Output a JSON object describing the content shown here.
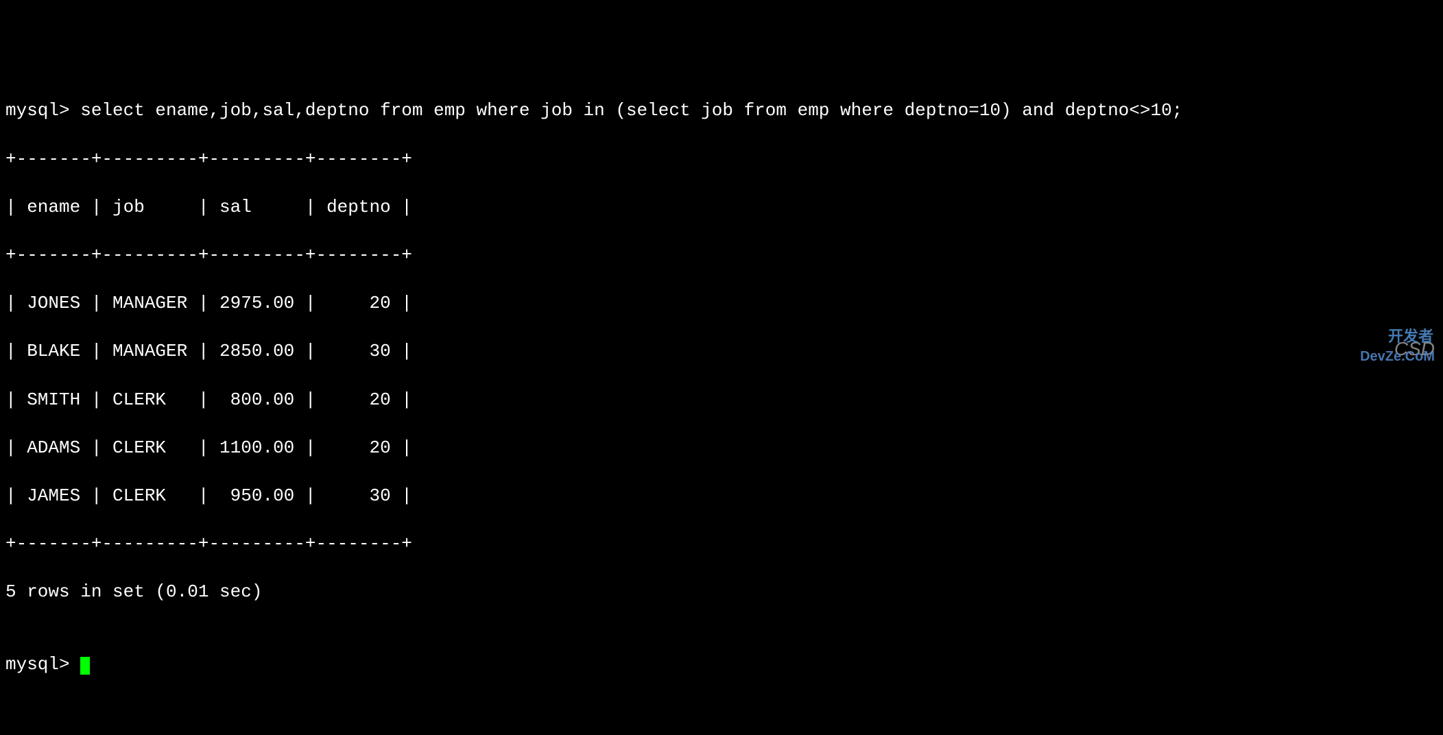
{
  "prompt1": "mysql> ",
  "query": "select ename,job,sal,deptno from emp where job in (select job from emp where deptno=10) and deptno<>10;",
  "table": {
    "border_top": "+-------+---------+---------+--------+",
    "header_line": "| ename | job     | sal     | deptno |",
    "border_mid": "+-------+---------+---------+--------+",
    "rows": [
      "| JONES | MANAGER | 2975.00 |     20 |",
      "| BLAKE | MANAGER | 2850.00 |     30 |",
      "| SMITH | CLERK   |  800.00 |     20 |",
      "| ADAMS | CLERK   | 1100.00 |     20 |",
      "| JAMES | CLERK   |  950.00 |     30 |"
    ],
    "border_bot": "+-------+---------+---------+--------+"
  },
  "result_summary": "5 rows in set (0.01 sec)",
  "blank": "",
  "prompt2": "mysql> ",
  "watermark_csd": "CSD",
  "watermark_dev": "开发者",
  "watermark_devze": "DevZe.CoM",
  "chart_data": {
    "type": "table",
    "columns": [
      "ename",
      "job",
      "sal",
      "deptno"
    ],
    "rows": [
      {
        "ename": "JONES",
        "job": "MANAGER",
        "sal": 2975.0,
        "deptno": 20
      },
      {
        "ename": "BLAKE",
        "job": "MANAGER",
        "sal": 2850.0,
        "deptno": 30
      },
      {
        "ename": "SMITH",
        "job": "CLERK",
        "sal": 800.0,
        "deptno": 20
      },
      {
        "ename": "ADAMS",
        "job": "CLERK",
        "sal": 1100.0,
        "deptno": 20
      },
      {
        "ename": "JAMES",
        "job": "CLERK",
        "sal": 950.0,
        "deptno": 30
      }
    ],
    "row_count": 5,
    "elapsed_sec": 0.01
  }
}
